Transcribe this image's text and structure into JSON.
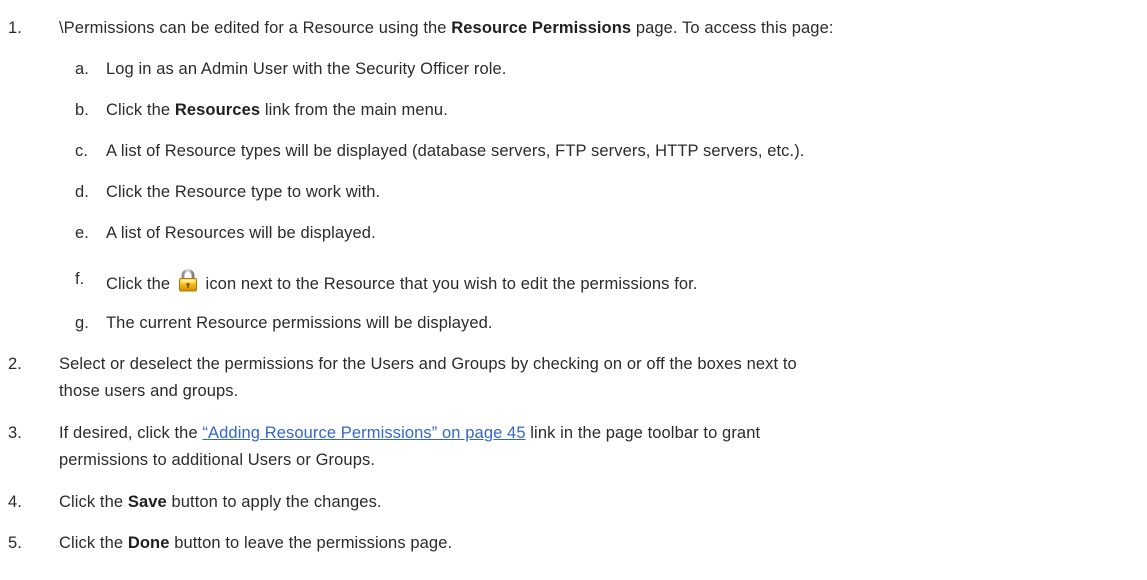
{
  "steps": [
    {
      "num": "1.",
      "pre": "\\Permissions can be edited for a Resource using the ",
      "bold": "Resource Permissions",
      "post": " page. To access this page:",
      "substeps": [
        {
          "letter": "a.",
          "text": "Log in as an Admin User with the Security Officer role."
        },
        {
          "letter": "b.",
          "pre": "Click the ",
          "bold": "Resources",
          "post": " link from the main menu."
        },
        {
          "letter": "c.",
          "text": "A list of Resource types will be displayed (database servers, FTP servers, HTTP servers, etc.)."
        },
        {
          "letter": "d.",
          "text": "Click the Resource type to work with."
        },
        {
          "letter": "e.",
          "text": "A list of Resources will be displayed."
        },
        {
          "letter": "f.",
          "pre": "Click the",
          "icon": "lock-icon",
          "post": "icon next to the Resource that you wish to edit the permissions for."
        },
        {
          "letter": "g.",
          "text": "The current Resource permissions will be displayed."
        }
      ]
    },
    {
      "num": "2.",
      "line1": "Select or deselect the permissions for the Users and Groups by checking on or off the boxes next to",
      "line2": "those users and groups."
    },
    {
      "num": "3.",
      "pre": "If desired, click the ",
      "link": "“Adding Resource Permissions” on page 45",
      "post": " link in the page toolbar to grant",
      "line2": "permissions to additional Users or Groups."
    },
    {
      "num": "4.",
      "pre": "Click the ",
      "bold": "Save",
      "post": " button to apply the changes."
    },
    {
      "num": "5.",
      "pre": "Click the ",
      "bold": "Done",
      "post": " button to leave the permissions page."
    }
  ],
  "colors": {
    "text": "#2b2b2b",
    "link": "#3366cc"
  }
}
